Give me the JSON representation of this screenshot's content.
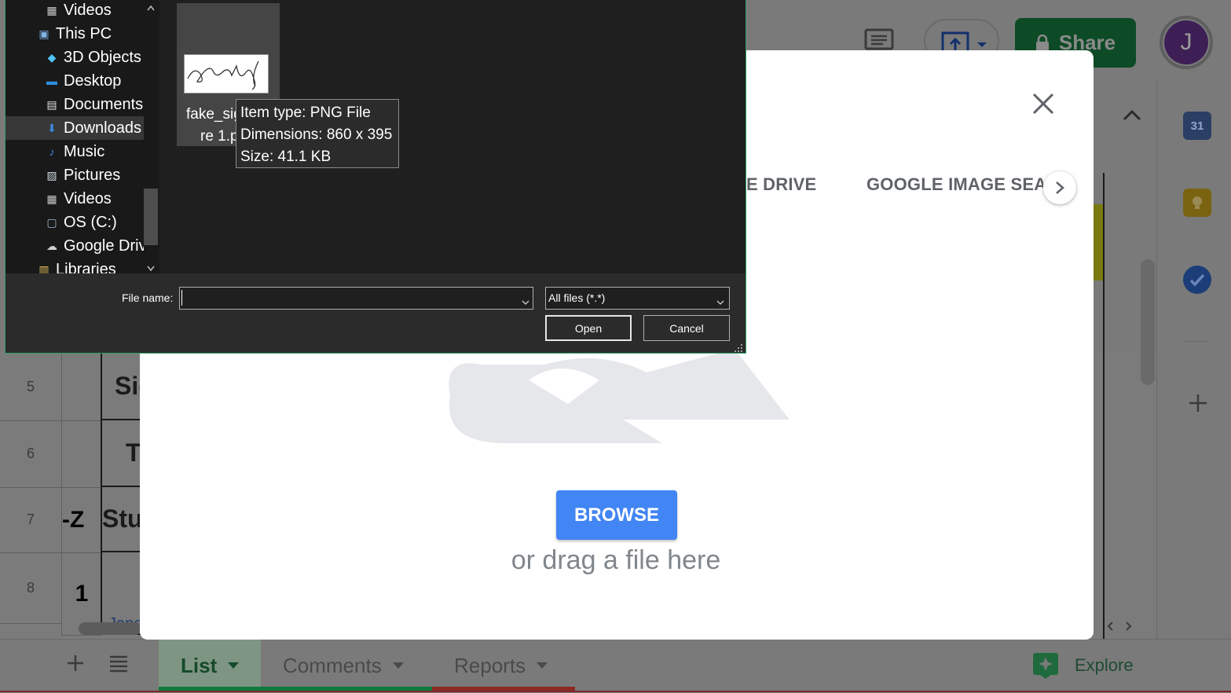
{
  "sheets": {
    "share_label": "Share",
    "avatar_initial": "J",
    "rows": [
      {
        "num": "5",
        "col2": "",
        "col3": "Sig"
      },
      {
        "num": "6",
        "col2": "",
        "col3": "Te"
      },
      {
        "num": "7",
        "col2": "-Z",
        "col3": "Stu"
      },
      {
        "num": "8",
        "col2": "1",
        "col3": "Jane"
      }
    ],
    "sheet_tabs": [
      {
        "label": "List",
        "color": "#0f9d58"
      },
      {
        "label": "Comments",
        "color": "#0f9d58"
      },
      {
        "label": "Reports",
        "color": "#db4437"
      }
    ],
    "explore_label": "Explore",
    "calendar_day": "31"
  },
  "modal": {
    "tabs": [
      "E DRIVE",
      "GOOGLE IMAGE SEARC"
    ],
    "browse_label": "BROWSE",
    "drag_text": "or drag a file here",
    "accent_color": "#4285f4"
  },
  "file_dialog": {
    "nav_items": [
      {
        "label": "Videos",
        "icon": "video-folder-icon",
        "indent": 1,
        "selected": false
      },
      {
        "label": "This PC",
        "icon": "computer-icon",
        "indent": 0,
        "selected": false
      },
      {
        "label": "3D Objects",
        "icon": "cube-icon",
        "indent": 1,
        "selected": false
      },
      {
        "label": "Desktop",
        "icon": "desktop-icon",
        "indent": 1,
        "selected": false
      },
      {
        "label": "Documents",
        "icon": "document-icon",
        "indent": 1,
        "selected": false
      },
      {
        "label": "Downloads",
        "icon": "download-icon",
        "indent": 1,
        "selected": true
      },
      {
        "label": "Music",
        "icon": "music-icon",
        "indent": 1,
        "selected": false
      },
      {
        "label": "Pictures",
        "icon": "pictures-icon",
        "indent": 1,
        "selected": false
      },
      {
        "label": "Videos",
        "icon": "video-folder-icon",
        "indent": 1,
        "selected": false
      },
      {
        "label": "OS (C:)",
        "icon": "drive-icon",
        "indent": 1,
        "selected": false
      },
      {
        "label": "Google Drive",
        "icon": "cloud-drive-icon",
        "indent": 1,
        "selected": false
      },
      {
        "label": "Libraries",
        "icon": "library-icon",
        "indent": 0,
        "selected": false
      }
    ],
    "file": {
      "name_line1": "fake_sig",
      "name_line2": "re 1.p"
    },
    "tooltip": {
      "type": "Item type: PNG File",
      "dimensions": "Dimensions: 860 x 395",
      "size": "Size: 41.1 KB"
    },
    "file_name_label": "File name:",
    "file_name_value": "",
    "filter_label": "All files (*.*)",
    "open_label": "Open",
    "cancel_label": "Cancel"
  }
}
